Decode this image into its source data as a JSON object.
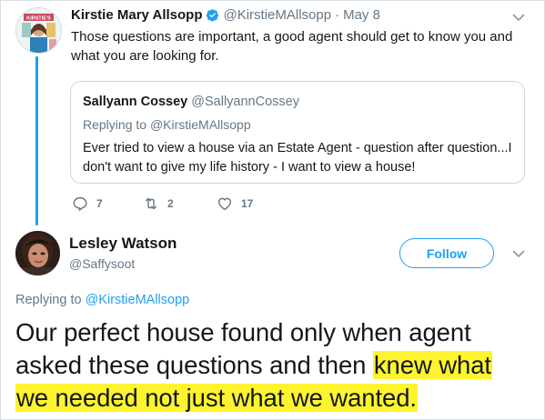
{
  "tweet1": {
    "author_name": "Kirstie Mary Allsopp",
    "author_handle": "@KirstieMAllsopp",
    "separator": "·",
    "date": "May 8",
    "text": "Those questions are important, a good agent should get to know you and what you are looking for.",
    "avatar_text": "KIRSTIE'S",
    "quote": {
      "author_name": "Sallyann Cossey",
      "author_handle": "@SallyannCossey",
      "replying_prefix": "Replying to",
      "replying_handle": "@KirstieMAllsopp",
      "text": "Ever tried to view a house via an Estate Agent - question after question...I don't want to give my life history - I want to view a house!"
    },
    "actions": {
      "reply_icon": "reply-icon",
      "reply_count": "7",
      "retweet_icon": "retweet-icon",
      "retweet_count": "2",
      "like_icon": "heart-icon",
      "like_count": "17"
    }
  },
  "tweet2": {
    "author_name": "Lesley Watson",
    "author_handle": "@Saffysoot",
    "follow_label": "Follow",
    "replying_prefix": "Replying to",
    "replying_handle": "@KirstieMAllsopp",
    "text_plain": "Our perfect house found only when agent asked these questions and then",
    "text_highlight_1": "knew what",
    "text_highlight_2": "we needed not just what we wanted.",
    "highlight_color": "#fdf42f"
  },
  "colors": {
    "accent": "#1da1f2",
    "muted": "#657786",
    "text": "#14171a"
  }
}
